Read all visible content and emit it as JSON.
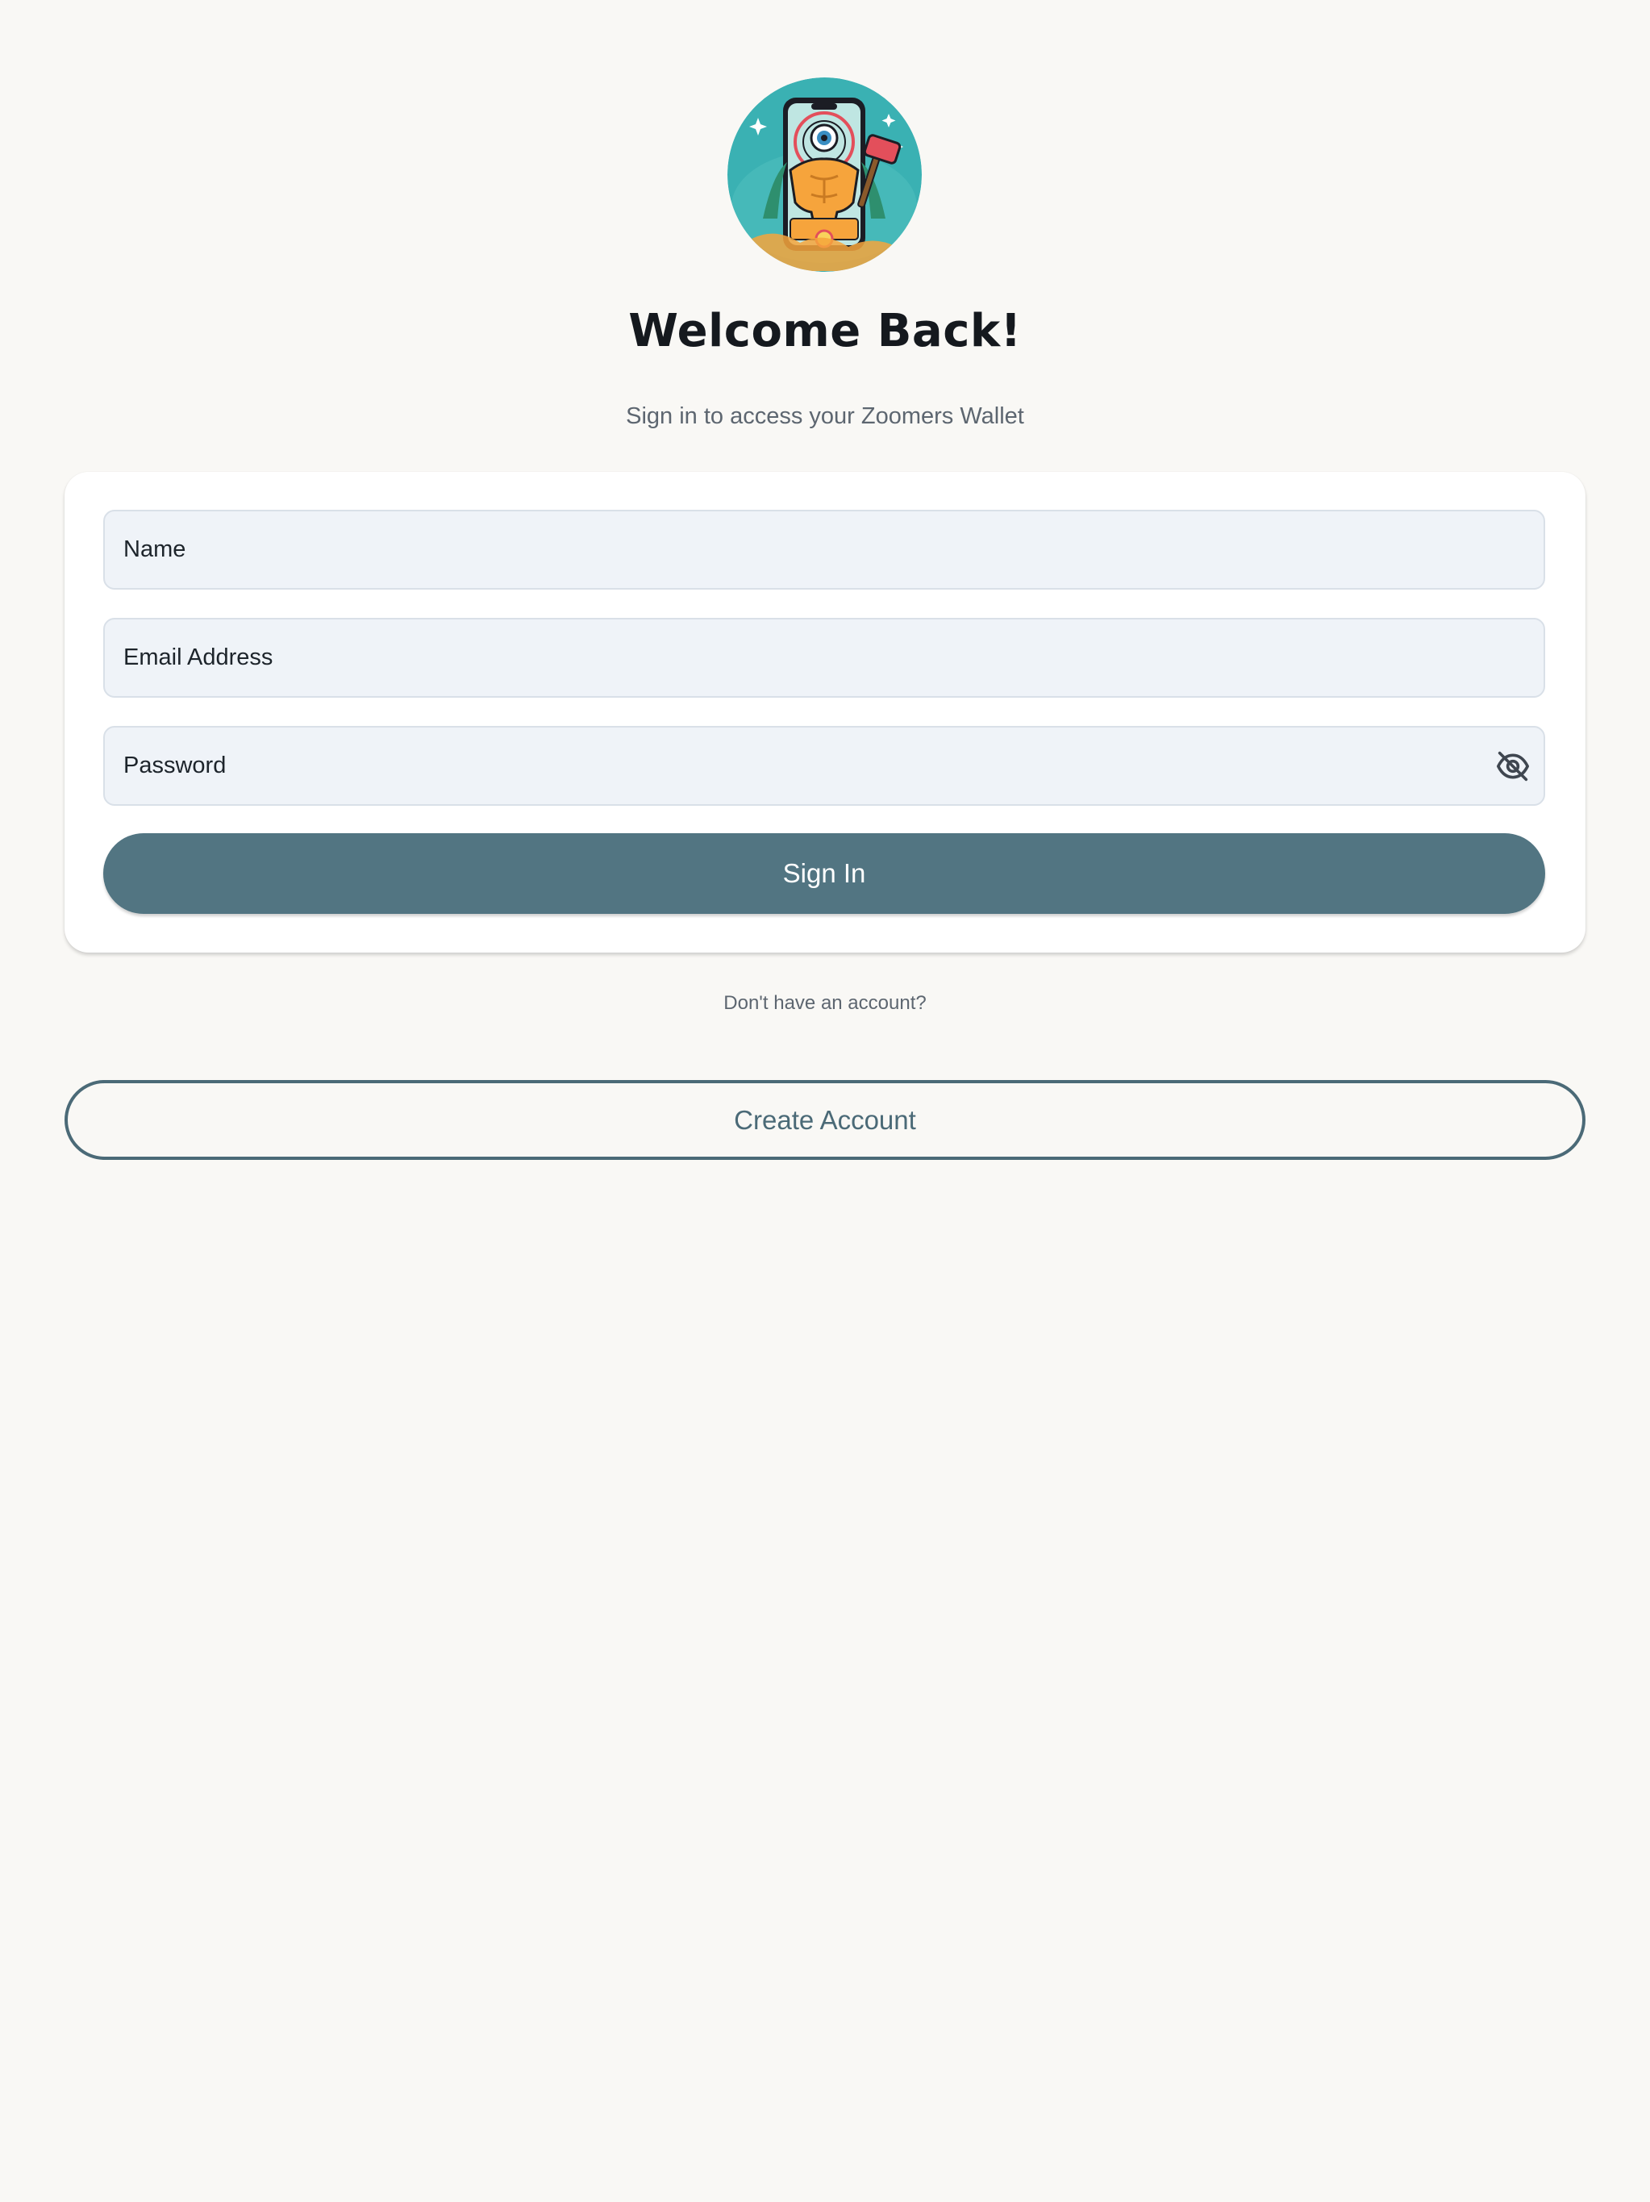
{
  "logo": {
    "alt": "Zoomers Wallet logo",
    "colors": {
      "background": "#3ab1b3",
      "figure": "#f6a43c",
      "hammer": "#e34f5b",
      "phone_frame": "#1b1d24"
    }
  },
  "header": {
    "title": "Welcome Back!",
    "subtitle": "Sign in to access your Zoomers Wallet"
  },
  "form": {
    "name_placeholder": "Name",
    "email_placeholder": "Email Address",
    "password_placeholder": "Password",
    "password_toggle_icon": "eye-off-icon",
    "sign_in_label": "Sign In"
  },
  "footer": {
    "no_account_text": "Don't have an account?",
    "create_account_label": "Create Account"
  },
  "colors": {
    "page_background": "#f9f8f5",
    "primary_button": "#527582",
    "input_background": "#eff3f8",
    "outline_button": "#4b6a77",
    "title_text": "#15191e",
    "muted_text": "#5d6670"
  }
}
